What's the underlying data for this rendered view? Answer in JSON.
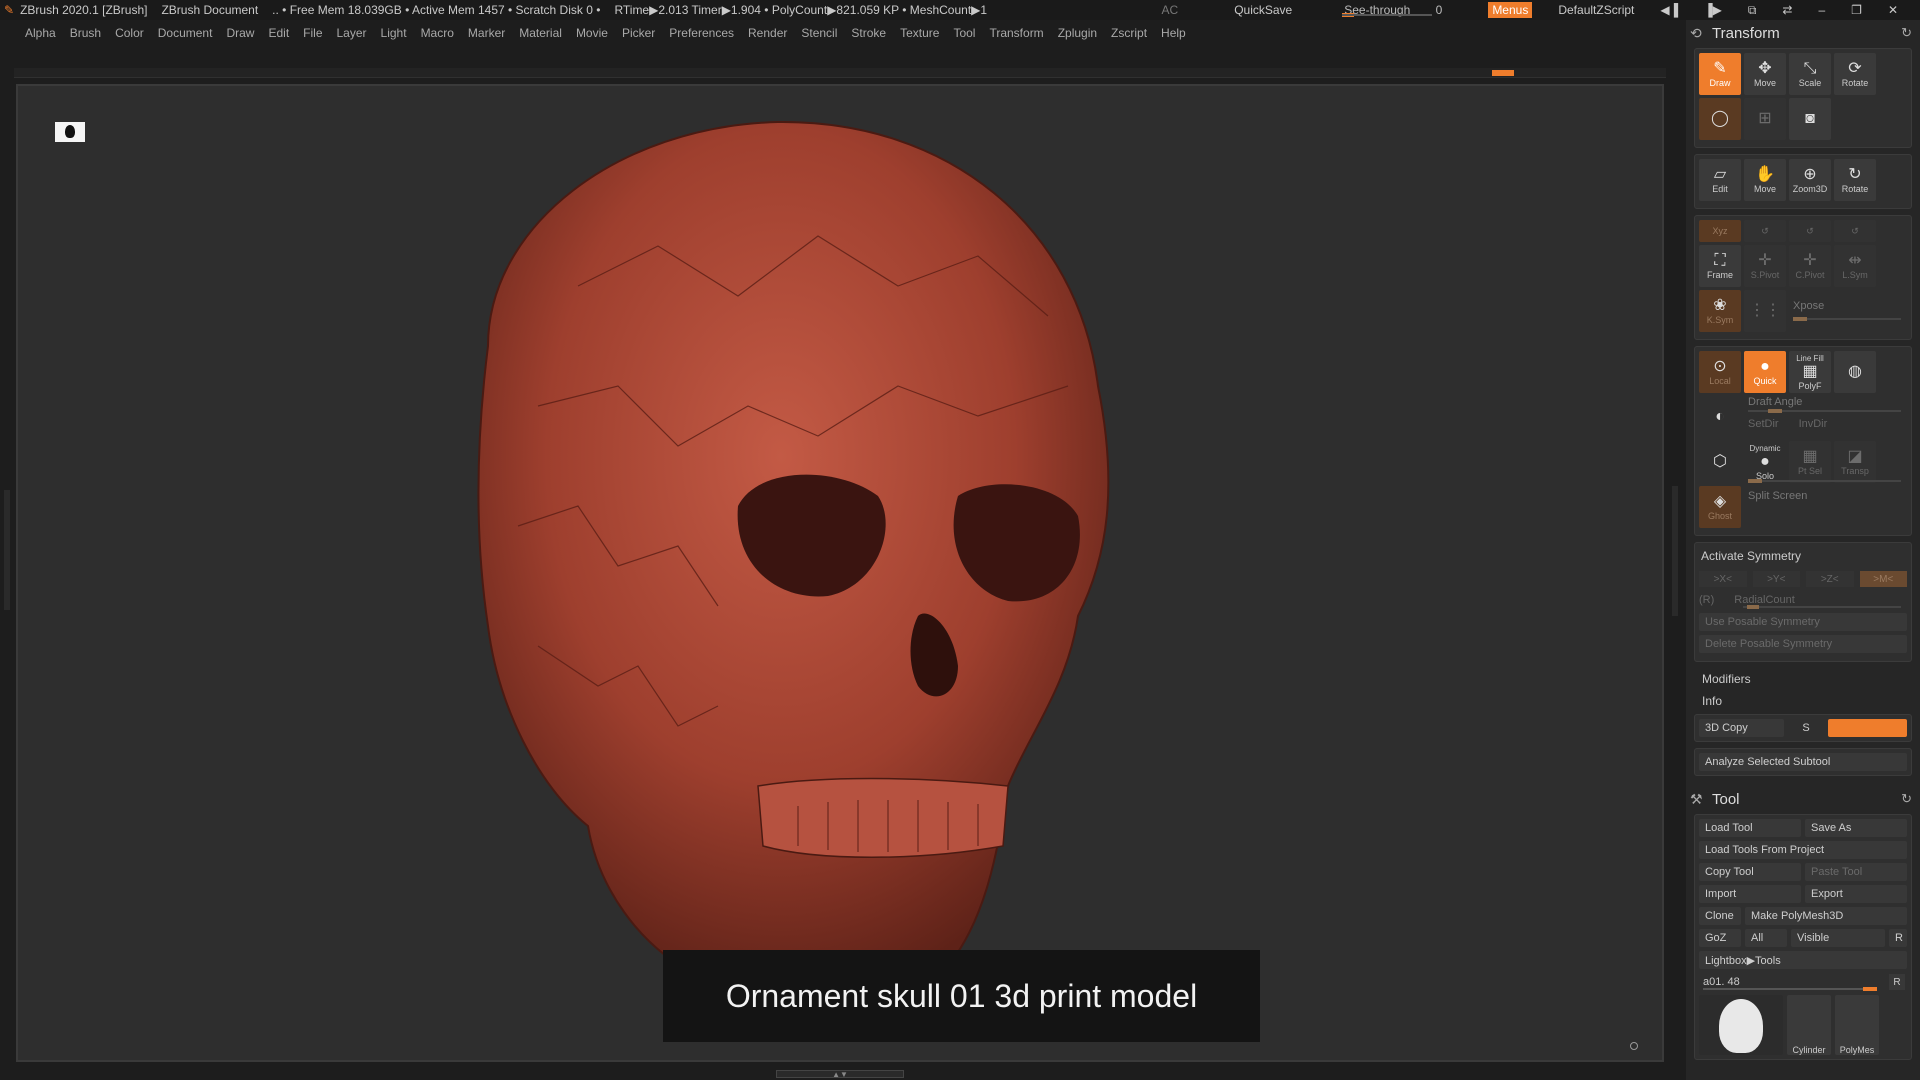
{
  "titlebar": {
    "app": "ZBrush 2020.1 [ZBrush]",
    "document": "ZBrush Document",
    "stats": ".. • Free Mem 18.039GB • Active Mem 1457 • Scratch Disk 0 •",
    "timing": "RTime▶2.013 Timer▶1.904 • PolyCount▶821.059 KP • MeshCount▶1",
    "ac": "AC",
    "quicksave": "QuickSave",
    "see_through_label": "See-through",
    "see_through_value": "0",
    "menus": "Menus",
    "script": "DefaultZScript"
  },
  "menubar": [
    "Alpha",
    "Brush",
    "Color",
    "Document",
    "Draw",
    "Edit",
    "File",
    "Layer",
    "Light",
    "Macro",
    "Marker",
    "Material",
    "Movie",
    "Picker",
    "Preferences",
    "Render",
    "Stencil",
    "Stroke",
    "Texture",
    "Tool",
    "Transform",
    "Zplugin",
    "Zscript",
    "Help"
  ],
  "viewport": {
    "caption": "Ornament skull 01 3d print model",
    "model_color": "#a3412f"
  },
  "transform": {
    "title": "Transform",
    "row1": [
      "Draw",
      "Move",
      "Scale",
      "Rotate"
    ],
    "row3": [
      "Edit",
      "Move",
      "Zoom3D",
      "Rotate"
    ],
    "xyz": "Xyz",
    "row4": [
      "Frame",
      "S.Pivot",
      "C.Pivot",
      "L.Sym"
    ],
    "row5": [
      "K.Sym",
      "Xpose"
    ],
    "xpose_label": "Xpose",
    "row6": [
      "Local",
      "Quick",
      "PolyF"
    ],
    "line_fill": "Line Fill",
    "draft_angle": "Draft Angle",
    "setdir": "SetDir",
    "invdir": "InvDir",
    "dynamic": "Dynamic",
    "row7": [
      "Solo",
      "Pt Sel",
      "Transp"
    ],
    "ghost": "Ghost",
    "split_screen": "Split Screen",
    "activate_symmetry": "Activate Symmetry",
    "sym_axes": [
      ">X<",
      ">Y<",
      ">Z<",
      ">M<"
    ],
    "radial_r": "(R)",
    "radial_count": "RadialCount",
    "use_posable": "Use Posable Symmetry",
    "delete_posable": "Delete Posable Symmetry",
    "modifiers": "Modifiers",
    "info": "Info",
    "copy3d": "3D Copy",
    "copy3d_s": "S",
    "analyze": "Analyze Selected Subtool"
  },
  "tool": {
    "title": "Tool",
    "load_tool": "Load Tool",
    "save_as": "Save As",
    "load_from_project": "Load Tools From Project",
    "copy_tool": "Copy Tool",
    "paste_tool": "Paste Tool",
    "import": "Import",
    "export": "Export",
    "clone": "Clone",
    "make_polymesh": "Make PolyMesh3D",
    "goz": "GoZ",
    "all": "All",
    "visible": "Visible",
    "r": "R",
    "lightbox_tools": "Lightbox▶Tools",
    "slot_name": "a01. 48",
    "thumbs": [
      "Cylinder",
      "PolyMes"
    ]
  }
}
